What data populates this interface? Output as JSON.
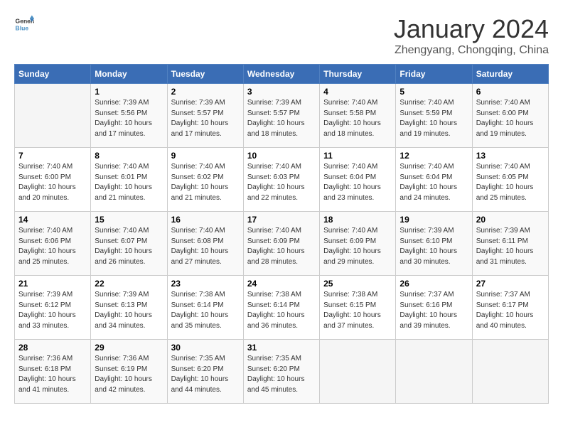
{
  "app": {
    "name_general": "General",
    "name_blue": "Blue"
  },
  "header": {
    "month": "January 2024",
    "location": "Zhengyang, Chongqing, China"
  },
  "calendar": {
    "days_of_week": [
      "Sunday",
      "Monday",
      "Tuesday",
      "Wednesday",
      "Thursday",
      "Friday",
      "Saturday"
    ],
    "weeks": [
      [
        {
          "day": "",
          "info": ""
        },
        {
          "day": "1",
          "info": "Sunrise: 7:39 AM\nSunset: 5:56 PM\nDaylight: 10 hours\nand 17 minutes."
        },
        {
          "day": "2",
          "info": "Sunrise: 7:39 AM\nSunset: 5:57 PM\nDaylight: 10 hours\nand 17 minutes."
        },
        {
          "day": "3",
          "info": "Sunrise: 7:39 AM\nSunset: 5:57 PM\nDaylight: 10 hours\nand 18 minutes."
        },
        {
          "day": "4",
          "info": "Sunrise: 7:40 AM\nSunset: 5:58 PM\nDaylight: 10 hours\nand 18 minutes."
        },
        {
          "day": "5",
          "info": "Sunrise: 7:40 AM\nSunset: 5:59 PM\nDaylight: 10 hours\nand 19 minutes."
        },
        {
          "day": "6",
          "info": "Sunrise: 7:40 AM\nSunset: 6:00 PM\nDaylight: 10 hours\nand 19 minutes."
        }
      ],
      [
        {
          "day": "7",
          "info": "Sunrise: 7:40 AM\nSunset: 6:00 PM\nDaylight: 10 hours\nand 20 minutes."
        },
        {
          "day": "8",
          "info": "Sunrise: 7:40 AM\nSunset: 6:01 PM\nDaylight: 10 hours\nand 21 minutes."
        },
        {
          "day": "9",
          "info": "Sunrise: 7:40 AM\nSunset: 6:02 PM\nDaylight: 10 hours\nand 21 minutes."
        },
        {
          "day": "10",
          "info": "Sunrise: 7:40 AM\nSunset: 6:03 PM\nDaylight: 10 hours\nand 22 minutes."
        },
        {
          "day": "11",
          "info": "Sunrise: 7:40 AM\nSunset: 6:04 PM\nDaylight: 10 hours\nand 23 minutes."
        },
        {
          "day": "12",
          "info": "Sunrise: 7:40 AM\nSunset: 6:04 PM\nDaylight: 10 hours\nand 24 minutes."
        },
        {
          "day": "13",
          "info": "Sunrise: 7:40 AM\nSunset: 6:05 PM\nDaylight: 10 hours\nand 25 minutes."
        }
      ],
      [
        {
          "day": "14",
          "info": "Sunrise: 7:40 AM\nSunset: 6:06 PM\nDaylight: 10 hours\nand 25 minutes."
        },
        {
          "day": "15",
          "info": "Sunrise: 7:40 AM\nSunset: 6:07 PM\nDaylight: 10 hours\nand 26 minutes."
        },
        {
          "day": "16",
          "info": "Sunrise: 7:40 AM\nSunset: 6:08 PM\nDaylight: 10 hours\nand 27 minutes."
        },
        {
          "day": "17",
          "info": "Sunrise: 7:40 AM\nSunset: 6:09 PM\nDaylight: 10 hours\nand 28 minutes."
        },
        {
          "day": "18",
          "info": "Sunrise: 7:40 AM\nSunset: 6:09 PM\nDaylight: 10 hours\nand 29 minutes."
        },
        {
          "day": "19",
          "info": "Sunrise: 7:39 AM\nSunset: 6:10 PM\nDaylight: 10 hours\nand 30 minutes."
        },
        {
          "day": "20",
          "info": "Sunrise: 7:39 AM\nSunset: 6:11 PM\nDaylight: 10 hours\nand 31 minutes."
        }
      ],
      [
        {
          "day": "21",
          "info": "Sunrise: 7:39 AM\nSunset: 6:12 PM\nDaylight: 10 hours\nand 33 minutes."
        },
        {
          "day": "22",
          "info": "Sunrise: 7:39 AM\nSunset: 6:13 PM\nDaylight: 10 hours\nand 34 minutes."
        },
        {
          "day": "23",
          "info": "Sunrise: 7:38 AM\nSunset: 6:14 PM\nDaylight: 10 hours\nand 35 minutes."
        },
        {
          "day": "24",
          "info": "Sunrise: 7:38 AM\nSunset: 6:14 PM\nDaylight: 10 hours\nand 36 minutes."
        },
        {
          "day": "25",
          "info": "Sunrise: 7:38 AM\nSunset: 6:15 PM\nDaylight: 10 hours\nand 37 minutes."
        },
        {
          "day": "26",
          "info": "Sunrise: 7:37 AM\nSunset: 6:16 PM\nDaylight: 10 hours\nand 39 minutes."
        },
        {
          "day": "27",
          "info": "Sunrise: 7:37 AM\nSunset: 6:17 PM\nDaylight: 10 hours\nand 40 minutes."
        }
      ],
      [
        {
          "day": "28",
          "info": "Sunrise: 7:36 AM\nSunset: 6:18 PM\nDaylight: 10 hours\nand 41 minutes."
        },
        {
          "day": "29",
          "info": "Sunrise: 7:36 AM\nSunset: 6:19 PM\nDaylight: 10 hours\nand 42 minutes."
        },
        {
          "day": "30",
          "info": "Sunrise: 7:35 AM\nSunset: 6:20 PM\nDaylight: 10 hours\nand 44 minutes."
        },
        {
          "day": "31",
          "info": "Sunrise: 7:35 AM\nSunset: 6:20 PM\nDaylight: 10 hours\nand 45 minutes."
        },
        {
          "day": "",
          "info": ""
        },
        {
          "day": "",
          "info": ""
        },
        {
          "day": "",
          "info": ""
        }
      ]
    ]
  }
}
